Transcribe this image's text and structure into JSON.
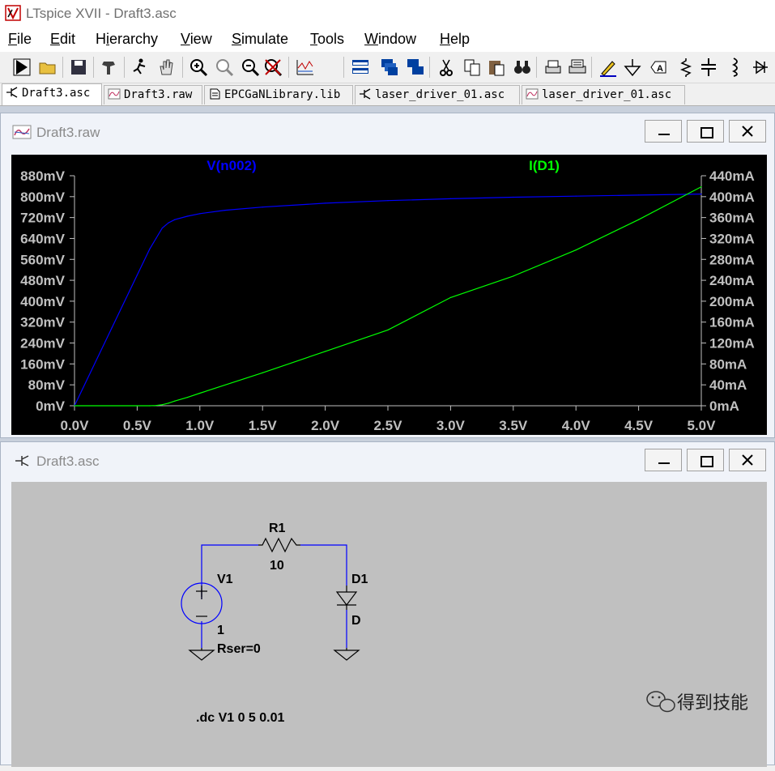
{
  "app": {
    "title": "LTspice XVII - Draft3.asc"
  },
  "menu": [
    {
      "pre": "",
      "u": "F",
      "post": "ile"
    },
    {
      "pre": "",
      "u": "E",
      "post": "dit"
    },
    {
      "pre": "H",
      "u": "i",
      "post": "erarchy"
    },
    {
      "pre": "",
      "u": "V",
      "post": "iew"
    },
    {
      "pre": "",
      "u": "S",
      "post": "imulate"
    },
    {
      "pre": "",
      "u": "T",
      "post": "ools"
    },
    {
      "pre": "",
      "u": "W",
      "post": "indow"
    },
    {
      "pre": "",
      "u": "H",
      "post": "elp"
    }
  ],
  "toolbar": [
    "run-icon",
    "open-icon",
    "save-icon",
    "control-panel-icon",
    "run-pause-icon",
    "pan-hand-icon",
    "zoom-in-icon",
    "zoom-area-icon",
    "zoom-out-icon",
    "zoom-cancel-icon",
    "autorange-icon",
    "tile-horizontal-icon",
    "cascade-icon",
    "tile-vertical-icon",
    "cut-icon",
    "copy-icon",
    "paste-icon",
    "find-icon",
    "print-icon",
    "print-setup-icon",
    "draw-wire-icon",
    "ground-icon",
    "label-net-icon",
    "resistor-icon",
    "capacitor-icon",
    "inductor-icon",
    "diode-icon"
  ],
  "tabs": [
    {
      "label": "Draft3.asc",
      "icon": "schematic-icon",
      "active": true
    },
    {
      "label": "Draft3.raw",
      "icon": "waveform-icon",
      "active": false
    },
    {
      "label": "EPCGaNLibrary.lib",
      "icon": "document-icon",
      "active": false
    },
    {
      "label": "laser_driver_01.asc",
      "icon": "schematic-icon",
      "active": false
    },
    {
      "label": "laser_driver_01.asc",
      "icon": "waveform-icon",
      "active": false
    }
  ],
  "plot_window": {
    "title": "Draft3.raw"
  },
  "schematic_window": {
    "title": "Draft3.asc"
  },
  "colors": {
    "plot_bg": "#000000",
    "v_trace": "#0000ff",
    "i_trace": "#00ff00",
    "axis_text": "#c0c0c0",
    "wire": "#0000ff",
    "schematic_bg": "#c0c0c0"
  },
  "chart_data": {
    "type": "line",
    "xlabel": "",
    "x_ticks": [
      "0.0V",
      "0.5V",
      "1.0V",
      "1.5V",
      "2.0V",
      "2.5V",
      "3.0V",
      "3.5V",
      "4.0V",
      "4.5V",
      "5.0V"
    ],
    "xlim": [
      0,
      5
    ],
    "left_ticks": [
      "0mV",
      "80mV",
      "160mV",
      "240mV",
      "320mV",
      "400mV",
      "480mV",
      "560mV",
      "640mV",
      "720mV",
      "800mV",
      "880mV"
    ],
    "left_lim_mV": [
      0,
      880
    ],
    "right_ticks": [
      "0mA",
      "40mA",
      "80mA",
      "120mA",
      "160mA",
      "200mA",
      "240mA",
      "280mA",
      "320mA",
      "360mA",
      "400mA",
      "440mA"
    ],
    "right_lim_mA": [
      0,
      440
    ],
    "series": [
      {
        "name": "V(n002)",
        "axis": "left",
        "color": "#0000ff",
        "x": [
          0,
          0.3,
          0.5,
          0.6,
          0.65,
          0.7,
          0.75,
          0.8,
          0.9,
          1.0,
          1.2,
          1.5,
          2.0,
          2.5,
          3.0,
          3.5,
          4.0,
          4.5,
          5.0
        ],
        "y": [
          0,
          300,
          500,
          600,
          640,
          680,
          700,
          712,
          725,
          735,
          748,
          760,
          775,
          785,
          792,
          798,
          802,
          806,
          810
        ]
      },
      {
        "name": "I(D1)",
        "axis": "right",
        "color": "#00ff00",
        "x": [
          0,
          0.6,
          0.65,
          0.7,
          0.75,
          0.8,
          0.9,
          1.0,
          1.5,
          2.0,
          2.5,
          3.0,
          3.5,
          4.0,
          4.5,
          5.0
        ],
        "y": [
          0,
          0,
          0.5,
          2,
          5,
          9,
          16,
          24,
          63,
          104,
          145,
          207,
          248,
          298,
          356,
          419
        ]
      }
    ]
  },
  "schematic": {
    "r1_name": "R1",
    "r1_value": "10",
    "v1_name": "V1",
    "v1_value": "1",
    "v1_rser": "Rser=0",
    "d1_name": "D1",
    "d1_model": "D",
    "directive": ".dc V1 0 5 0.01"
  },
  "watermark": {
    "text": "得到技能"
  }
}
